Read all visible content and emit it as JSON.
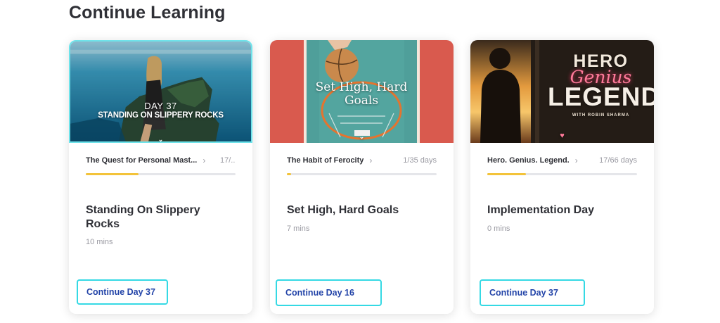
{
  "page": {
    "section_title": "Continue Learning"
  },
  "colors": {
    "accent": "#35d9e4",
    "progress": "#f3c33a",
    "button_text": "#2344a8"
  },
  "cards": [
    {
      "thumbnail": {
        "day_text": "DAY 37",
        "title_text": "STANDING ON SLIPPERY ROCKS"
      },
      "course": "The Quest for Personal Mast...",
      "days": "17/...",
      "progress_percent": 35,
      "lesson_title": "Standing On Slippery Rocks",
      "duration": "10 mins",
      "button_label": "Continue Day 37"
    },
    {
      "thumbnail": {
        "title_text": "Set High, Hard Goals"
      },
      "course": "The Habit of Ferocity",
      "days": "1/35 days",
      "progress_percent": 3,
      "lesson_title": "Set High, Hard Goals",
      "duration": "7 mins",
      "button_label": "Continue Day 16"
    },
    {
      "thumbnail": {
        "hero": "HERO",
        "genius": "Genius",
        "legend": "LEGEND",
        "with": "WITH ROBIN SHARMA"
      },
      "course": "Hero. Genius. Legend.",
      "days": "17/66 days",
      "progress_percent": 26,
      "lesson_title": "Implementation Day",
      "duration": "0 mins",
      "button_label": "Continue Day 37"
    }
  ]
}
